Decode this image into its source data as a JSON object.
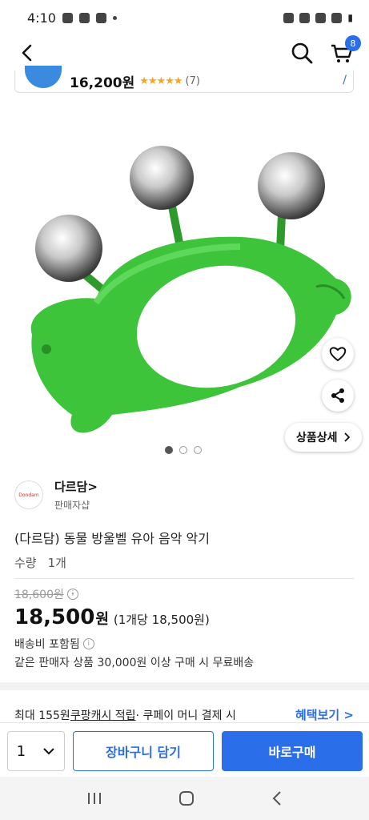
{
  "status_bar": {
    "time": "4:10",
    "battery_label": "▮"
  },
  "header": {
    "cart_count": "8"
  },
  "mini_card": {
    "price": "16,200원",
    "stars": "★★★★★",
    "review_count": "(7)"
  },
  "gallery": {
    "detail_button": "상품상세"
  },
  "seller": {
    "name": "다르담>",
    "logo_text": "Dondam",
    "type": "판매자샵"
  },
  "product": {
    "title": "(다르담) 동물 방울벨 유아 음악 악기",
    "qty_label": "수량",
    "qty_value": "1개",
    "original_price": "18,600원",
    "sale_price": "18,500",
    "sale_unit": "원",
    "per_unit": "(1개당 18,500원)",
    "shipping": "배송비 포함됨",
    "shipping_note": "같은 판매자 상품 30,000원 이상 구매 시 무료배송"
  },
  "cash": {
    "prefix": "최대 155원 ",
    "link": "쿠팡캐시 적립",
    "suffix": " · 쿠페이 머니 결제 시",
    "benefit": "혜택보기 >"
  },
  "buy_bar": {
    "qty": "1",
    "cart": "장바구니 담기",
    "buy": "바로구매"
  },
  "colors": {
    "accent": "#2b6eea",
    "toy_green": "#3ec43a",
    "star": "#f5a623"
  }
}
